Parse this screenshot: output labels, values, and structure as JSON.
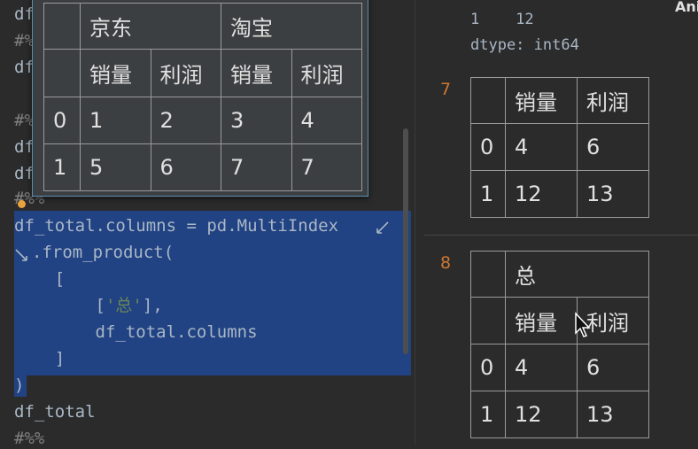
{
  "editor": {
    "bg_lines": {
      "l1": "df",
      "l2": "#%",
      "l3": "df",
      "l4": "#%",
      "l5": "df",
      "l6": "df",
      "l7": "#%%"
    },
    "code": {
      "line1": "df_total.columns = pd.MultiIndex",
      "line2": ".from_product(",
      "line3": "    [",
      "line4_a": "        [",
      "line4_str": "'总'",
      "line4_b": "],",
      "line5": "        df_total.columns",
      "line6": "    ]",
      "line7": ")",
      "line8": "df_total",
      "line9": "#%%"
    }
  },
  "popup_table": {
    "header_top": [
      "京东",
      "淘宝"
    ],
    "header_sub": [
      "销量",
      "利润",
      "销量",
      "利润"
    ],
    "rows": [
      {
        "index": "0",
        "values": [
          "1",
          "2",
          "3",
          "4"
        ]
      },
      {
        "index": "1",
        "values": [
          "5",
          "6",
          "7",
          "7"
        ]
      }
    ]
  },
  "output": {
    "series_row": "1    12",
    "dtype": "dtype: int64",
    "cell7": {
      "number": "7",
      "headers": [
        "销量",
        "利润"
      ],
      "rows": [
        {
          "index": "0",
          "values": [
            "4",
            "6"
          ]
        },
        {
          "index": "1",
          "values": [
            "12",
            "13"
          ]
        }
      ]
    },
    "cell8": {
      "number": "8",
      "header_top": "总",
      "headers": [
        "销量",
        "利润"
      ],
      "rows": [
        {
          "index": "0",
          "values": [
            "4",
            "6"
          ]
        },
        {
          "index": "1",
          "values": [
            "12",
            "13"
          ]
        }
      ]
    },
    "corner_label": "Ani"
  },
  "colors": {
    "selection": "#214283",
    "editor_bg": "#2b2b2b",
    "cell_number": "#cc7832",
    "string": "#6a8759"
  }
}
